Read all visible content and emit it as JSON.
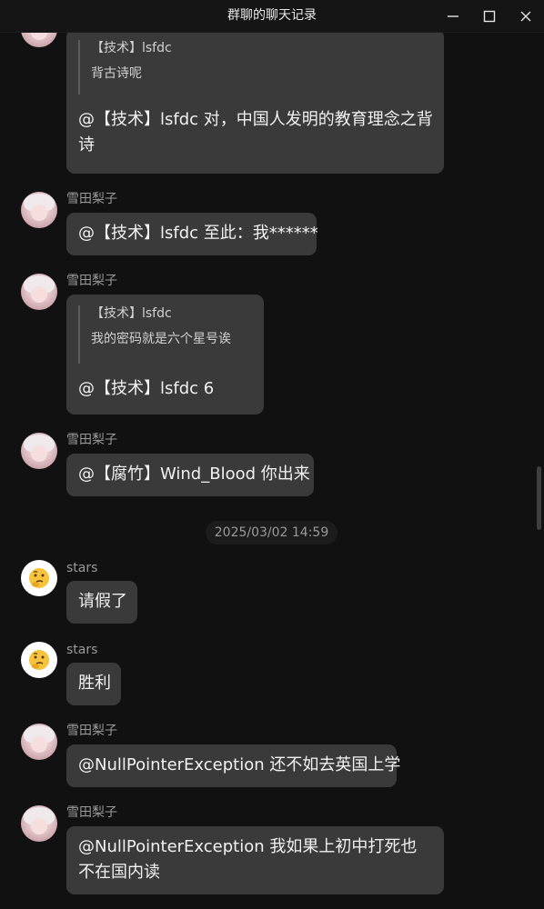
{
  "window": {
    "title": "群聊的聊天记录",
    "controls": [
      "minimize-icon",
      "maximize-icon",
      "close-icon"
    ]
  },
  "messages": [
    {
      "sender": "",
      "avatar": "girl-avatar",
      "quote": {
        "author": "【技术】lsfdc",
        "text": "背古诗呢"
      },
      "text": "@【技术】lsfdc 对，中国人发明的教育理念之背诗"
    },
    {
      "sender": "雪田梨子",
      "avatar": "girl-avatar",
      "text": "@【技术】lsfdc 至此：我******"
    },
    {
      "sender": "雪田梨子",
      "avatar": "girl-avatar",
      "quote": {
        "author": "【技术】lsfdc",
        "text": "我的密码就是六个星号诶"
      },
      "text": "@【技术】lsfdc 6"
    },
    {
      "sender": "雪田梨子",
      "avatar": "girl-avatar",
      "text": "@【腐竹】Wind_Blood 你出来"
    },
    {
      "sender": "stars",
      "avatar": "thinking-face-icon",
      "text": "请假了"
    },
    {
      "sender": "stars",
      "avatar": "thinking-face-icon",
      "text": "胜利"
    },
    {
      "sender": "雪田梨子",
      "avatar": "girl-avatar",
      "text": "@NullPointerException 还不如去英国上学"
    },
    {
      "sender": "雪田梨子",
      "avatar": "girl-avatar",
      "text": "@NullPointerException 我如果上初中打死也不在国内读"
    }
  ],
  "timestamp": "2025/03/02 14:59",
  "colors": {
    "background": "#111111",
    "bubble": "#3a3a3a",
    "sender": "#9a9a9a",
    "text": "#f2f2f2"
  }
}
